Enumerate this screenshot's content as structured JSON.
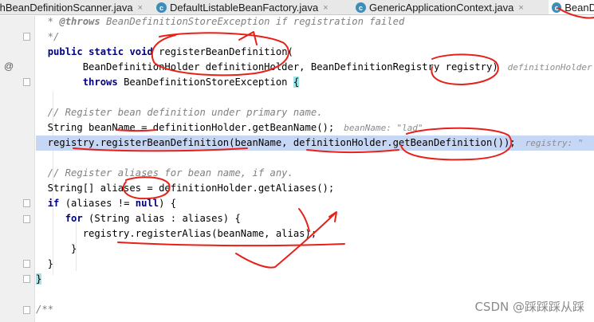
{
  "tabs": [
    {
      "label": "thBeanDefinitionScanner.java",
      "icon": ""
    },
    {
      "label": "DefaultListableBeanFactory.java",
      "icon": "c"
    },
    {
      "label": "GenericApplicationContext.java",
      "icon": "c"
    },
    {
      "label": "BeanD",
      "icon": "c"
    }
  ],
  "tab_close": "×",
  "gutter_marker": "@",
  "code": {
    "l1": {
      "a": "  * ",
      "tag": "@throws",
      "b": " BeanDefinitionStoreException if registration failed"
    },
    "l2": "  */",
    "l3": {
      "kw1": "public",
      "kw2": "static",
      "kw3": "void",
      "rest": " registerBeanDefinition("
    },
    "l4": {
      "text": "        BeanDefinitionHolder definitionHolder, BeanDefinitionRegistry registry)",
      "hint": "definitionHolder"
    },
    "l5": {
      "kw": "throws",
      "rest": " BeanDefinitionStoreException ",
      "brace": "{"
    },
    "l6": "",
    "l7": "  // Register bean definition under primary name.",
    "l8": {
      "text": "  String beanName = definitionHolder.getBeanName();",
      "hint": "beanName: \"lad\""
    },
    "l9": {
      "text": "  registry.registerBeanDefinition(beanName, definitionHolder.getBeanDefinition());",
      "hint": "registry: \""
    },
    "l10": "",
    "l11": "  // Register aliases for bean name, if any.",
    "l12": "  String[] aliases = definitionHolder.getAliases();",
    "l13": {
      "kw": "if",
      "rest": " (aliases != ",
      "kw2": "null",
      "rest2": ") {"
    },
    "l14": {
      "kw": "for",
      "rest": " (String alias : aliases) {"
    },
    "l15": "        registry.registerAlias(beanName, alias);",
    "l16": "      }",
    "l17": "  }",
    "l18": "}",
    "l19": "",
    "l20": "/**"
  },
  "watermark": "CSDN @踩踩踩从踩",
  "colors": {
    "ink": "#e8201a",
    "keyword": "#000080",
    "comment": "#808080",
    "highlight": "#c6d6f5"
  }
}
